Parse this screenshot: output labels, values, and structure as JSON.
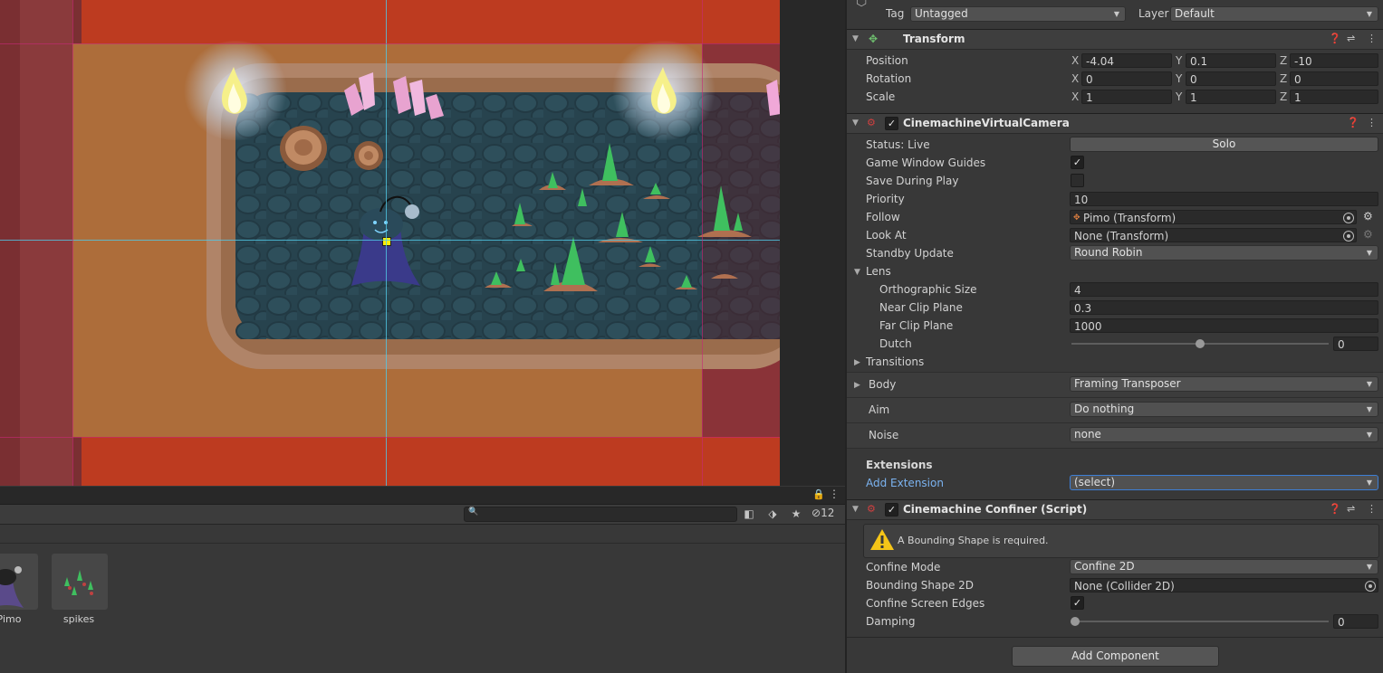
{
  "inspector": {
    "tag_label": "Tag",
    "tag_value": "Untagged",
    "layer_label": "Layer",
    "layer_value": "Default",
    "transform": {
      "title": "Transform",
      "position_label": "Position",
      "rotation_label": "Rotation",
      "scale_label": "Scale",
      "axis_x": "X",
      "axis_y": "Y",
      "axis_z": "Z",
      "position": {
        "x": "-4.04",
        "y": "0.1",
        "z": "-10"
      },
      "rotation": {
        "x": "0",
        "y": "0",
        "z": "0"
      },
      "scale": {
        "x": "1",
        "y": "1",
        "z": "1"
      }
    },
    "vcam": {
      "title": "CinemachineVirtualCamera",
      "status_label": "Status: Live",
      "solo_label": "Solo",
      "game_window_guides_label": "Game Window Guides",
      "save_during_play_label": "Save During Play",
      "priority_label": "Priority",
      "priority_value": "10",
      "follow_label": "Follow",
      "follow_value": "Pimo (Transform)",
      "look_at_label": "Look At",
      "look_at_value": "None (Transform)",
      "standby_label": "Standby Update",
      "standby_value": "Round Robin",
      "lens_label": "Lens",
      "ortho_label": "Orthographic Size",
      "ortho_value": "4",
      "near_label": "Near Clip Plane",
      "near_value": "0.3",
      "far_label": "Far Clip Plane",
      "far_value": "1000",
      "dutch_label": "Dutch",
      "dutch_value": "0",
      "transitions_label": "Transitions",
      "body_label": "Body",
      "body_value": "Framing Transposer",
      "aim_label": "Aim",
      "aim_value": "Do nothing",
      "noise_label": "Noise",
      "noise_value": "none",
      "extensions_label": "Extensions",
      "add_extension_label": "Add Extension",
      "add_extension_value": "(select)"
    },
    "confiner": {
      "title": "Cinemachine Confiner (Script)",
      "warning": "A Bounding Shape is required.",
      "mode_label": "Confine Mode",
      "mode_value": "Confine 2D",
      "shape_label": "Bounding Shape 2D",
      "shape_value": "None (Collider 2D)",
      "edges_label": "Confine Screen Edges",
      "damping_label": "Damping",
      "damping_value": "0"
    },
    "add_component_label": "Add Component"
  },
  "project": {
    "hidden_count": "12",
    "assets": [
      {
        "name": "Pimo"
      },
      {
        "name": "spikes"
      }
    ]
  },
  "colors": {
    "scene_background": "#bd3b20",
    "link_blue": "#7bb3f0",
    "warning_yellow": "#f5c518"
  }
}
